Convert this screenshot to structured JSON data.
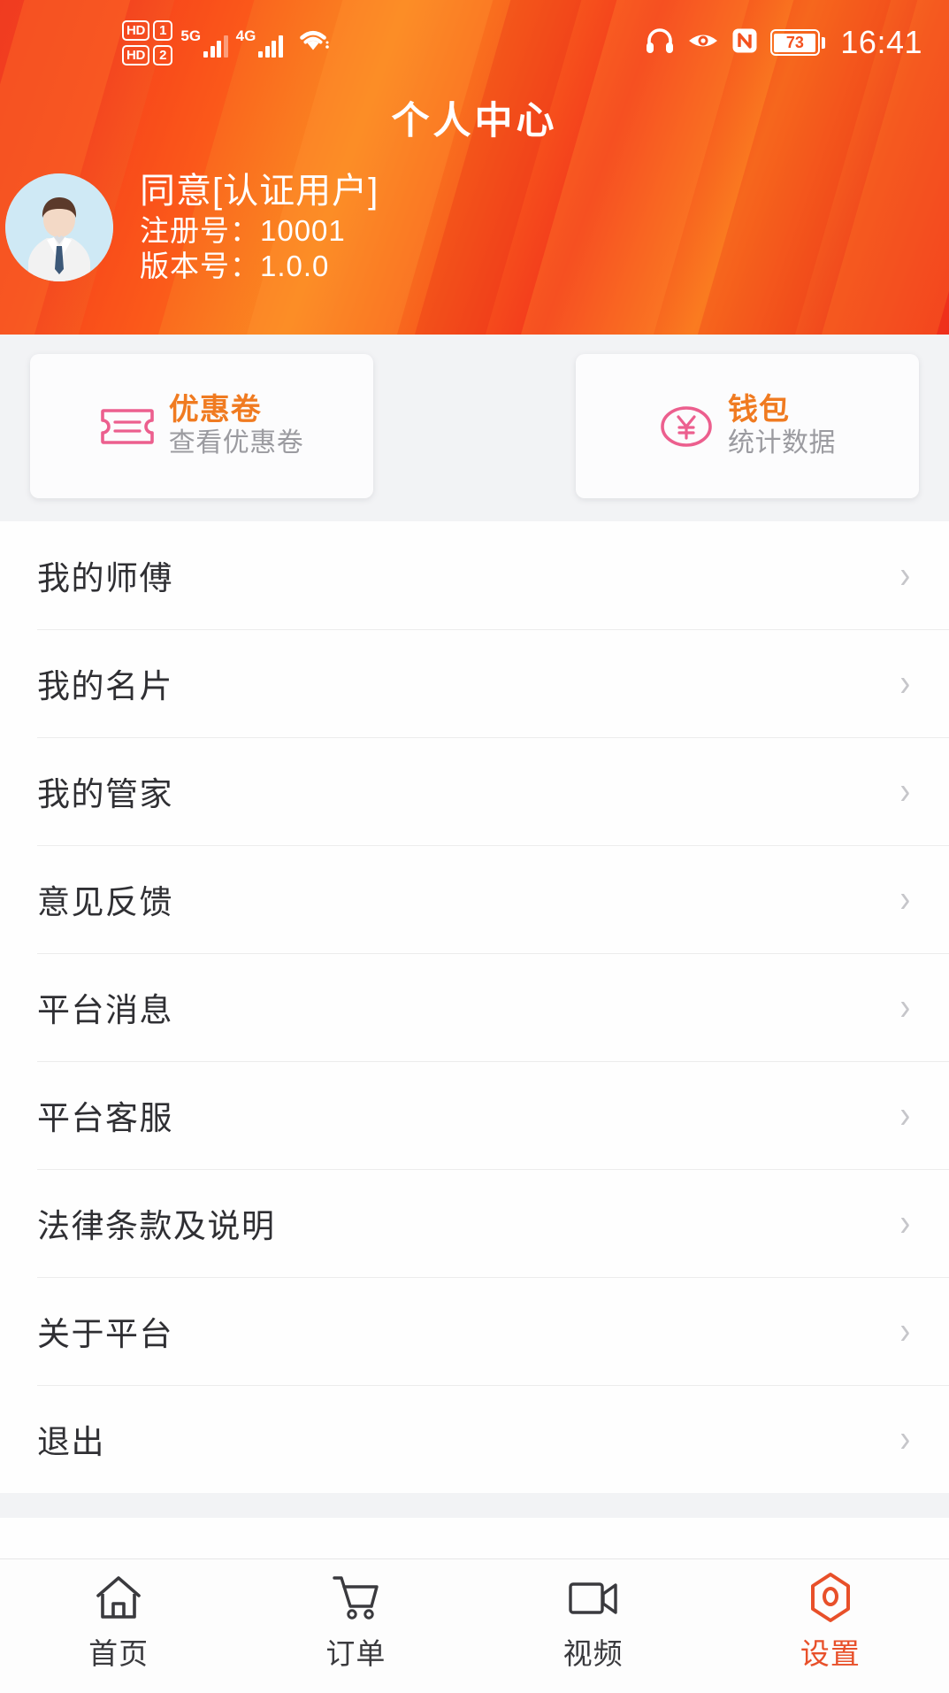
{
  "statusbar": {
    "sim1_label": "HD",
    "sim1_num": "1",
    "sim2_label": "HD",
    "sim2_num": "2",
    "net1": "5G",
    "net2": "4G",
    "wifi_icon": "wifi-icon",
    "headphone_icon": "headphone-icon",
    "eye_icon": "eye-comfort-icon",
    "nfc_icon": "nfc-icon",
    "battery_level": "73",
    "time": "16:41"
  },
  "header": {
    "title": "个人中心",
    "avatar_icon": "user-avatar",
    "user_name": "同意[认证用户]",
    "register_line": "注册号：10001",
    "version_line": "版本号：1.0.0",
    "bg_color": "#f4451f"
  },
  "cards": [
    {
      "icon": "coupon-ticket-icon",
      "title": "优惠卷",
      "subtitle": "查看优惠卷",
      "icon_color": "#ec5f8e",
      "title_color": "#f07b21"
    },
    {
      "icon": "wallet-yuan-icon",
      "title": "钱包",
      "subtitle": "统计数据",
      "icon_color": "#ec5f8e",
      "title_color": "#f07b21"
    }
  ],
  "menu": {
    "chevron": "›",
    "items": [
      {
        "label": "我的师傅",
        "name": "menu-item-my-master"
      },
      {
        "label": "我的名片",
        "name": "menu-item-my-card"
      },
      {
        "label": "我的管家",
        "name": "menu-item-my-steward"
      },
      {
        "label": "意见反馈",
        "name": "menu-item-feedback"
      },
      {
        "label": "平台消息",
        "name": "menu-item-platform-message"
      },
      {
        "label": "平台客服",
        "name": "menu-item-platform-service"
      },
      {
        "label": "法律条款及说明",
        "name": "menu-item-legal-terms"
      },
      {
        "label": "关于平台",
        "name": "menu-item-about"
      },
      {
        "label": "退出",
        "name": "menu-item-logout"
      }
    ]
  },
  "tabbar": {
    "active_color": "#e8502a",
    "items": [
      {
        "label": "首页",
        "icon": "home-icon",
        "active": false
      },
      {
        "label": "订单",
        "icon": "shopping-cart-icon",
        "active": false
      },
      {
        "label": "视频",
        "icon": "video-camera-icon",
        "active": false
      },
      {
        "label": "设置",
        "icon": "settings-hexagon-icon",
        "active": true
      }
    ]
  }
}
